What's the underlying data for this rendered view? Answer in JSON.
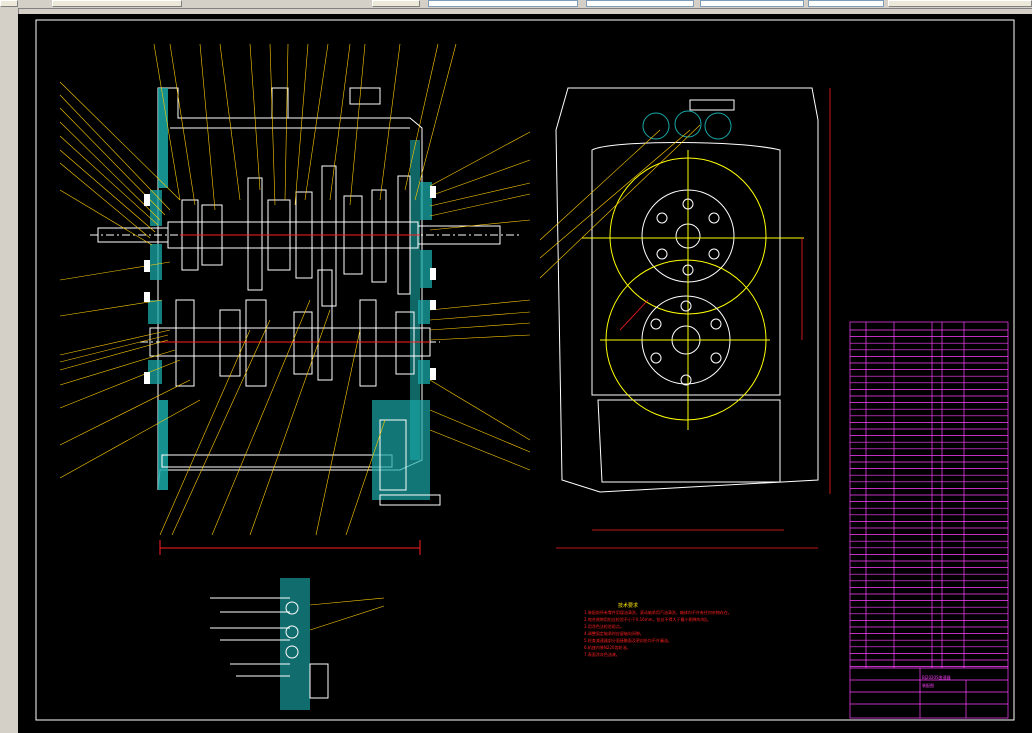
{
  "window": {
    "toolbar_fields": [
      "",
      "",
      "",
      ""
    ]
  },
  "drawing": {
    "accent_colors": {
      "background": "#000000",
      "outline": "#ffffff",
      "leader": "#ffcc00",
      "hatch": "#1aa8a8",
      "dimension": "#ff2020",
      "centerline": "#ffff00",
      "title_block": "#ff40ff"
    },
    "tech_notes_title": "技术要求",
    "tech_notes": [
      "1.装配前所有零件用煤油清洗，滚动轴承用汽油清洗，箱体内不许有任何杂物存在。",
      "2.啮合侧隙用铅丝检验不小于0.16mm，铅丝不得大于最小侧隙的4倍。",
      "3.用涂色法检验斑点。",
      "4.调整固定轴承时应留轴向间隙。",
      "5.检查减速器剖分面接触面及密封处均不许漏油。",
      "6.机座内装N220齿轮油。",
      "7.表面涂灰色油漆。"
    ],
    "title_block": {
      "name": "BJ2020S变速器",
      "subtitle": "装配图"
    }
  }
}
